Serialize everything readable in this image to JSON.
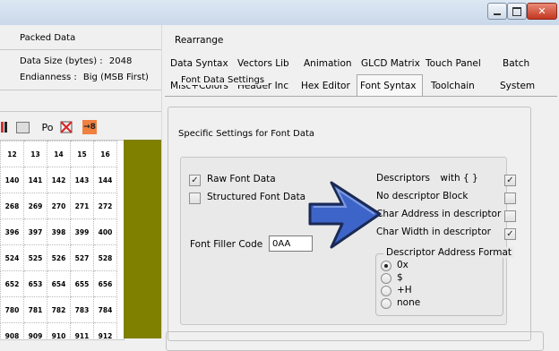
{
  "window": {
    "controls": {
      "minimize": "—",
      "maximize": "□",
      "close": "✕"
    }
  },
  "left_panel": {
    "packed_title": "Packed Data",
    "data_size_label": "Data Size (bytes) :",
    "data_size_value": "2048",
    "endianness_label": "Endianness :",
    "endianness_value": "Big (MSB First)",
    "toolbar_po_label": "Po",
    "toolbar_badge": "→8",
    "grid_rows": [
      [
        "12",
        "13",
        "14",
        "15",
        "16"
      ],
      [
        "140",
        "141",
        "142",
        "143",
        "144"
      ],
      [
        "268",
        "269",
        "270",
        "271",
        "272"
      ],
      [
        "396",
        "397",
        "398",
        "399",
        "400"
      ],
      [
        "524",
        "525",
        "526",
        "527",
        "528"
      ],
      [
        "652",
        "653",
        "654",
        "655",
        "656"
      ],
      [
        "780",
        "781",
        "782",
        "783",
        "784"
      ],
      [
        "908",
        "909",
        "910",
        "911",
        "912"
      ]
    ]
  },
  "tabs": {
    "row1": [
      "Rearrange"
    ],
    "row2": [
      "Data Syntax",
      "Vectors Lib",
      "Animation",
      "GLCD Matrix",
      "Touch Panel",
      "Batch"
    ],
    "row3": [
      "Misc+Colors",
      "Header Inc",
      "Hex Editor",
      "Font Syntax",
      "Toolchain",
      "System"
    ],
    "active": "Font Syntax"
  },
  "font_data_settings": {
    "group_title": "Font Data Settings",
    "subtitle": "Specific Settings for Font Data",
    "raw_font_data": {
      "label": "Raw Font Data",
      "checked": true
    },
    "structured_font_data": {
      "label": "Structured Font Data",
      "checked": false
    },
    "descriptors": {
      "label": "Descriptors",
      "suffix": "with { }",
      "checked": true
    },
    "no_descriptor_block": {
      "label": "No descriptor Block",
      "checked": false
    },
    "char_address": {
      "label": "Char Address in descriptor",
      "checked": false
    },
    "char_width": {
      "label": "Char Width in descriptor",
      "checked": true
    },
    "font_filler": {
      "label": "Font Filler Code",
      "value": "0AA"
    },
    "descriptor_address_format": {
      "title": "Descriptor Address Format",
      "options": [
        "0x",
        "$",
        "+H",
        "none"
      ],
      "selected": "0x"
    }
  },
  "colors": {
    "arrow_fill": "#3d64c8",
    "arrow_stroke": "#1a2a55",
    "olive_panel": "#7f7f00",
    "badge_orange": "#f08040"
  }
}
